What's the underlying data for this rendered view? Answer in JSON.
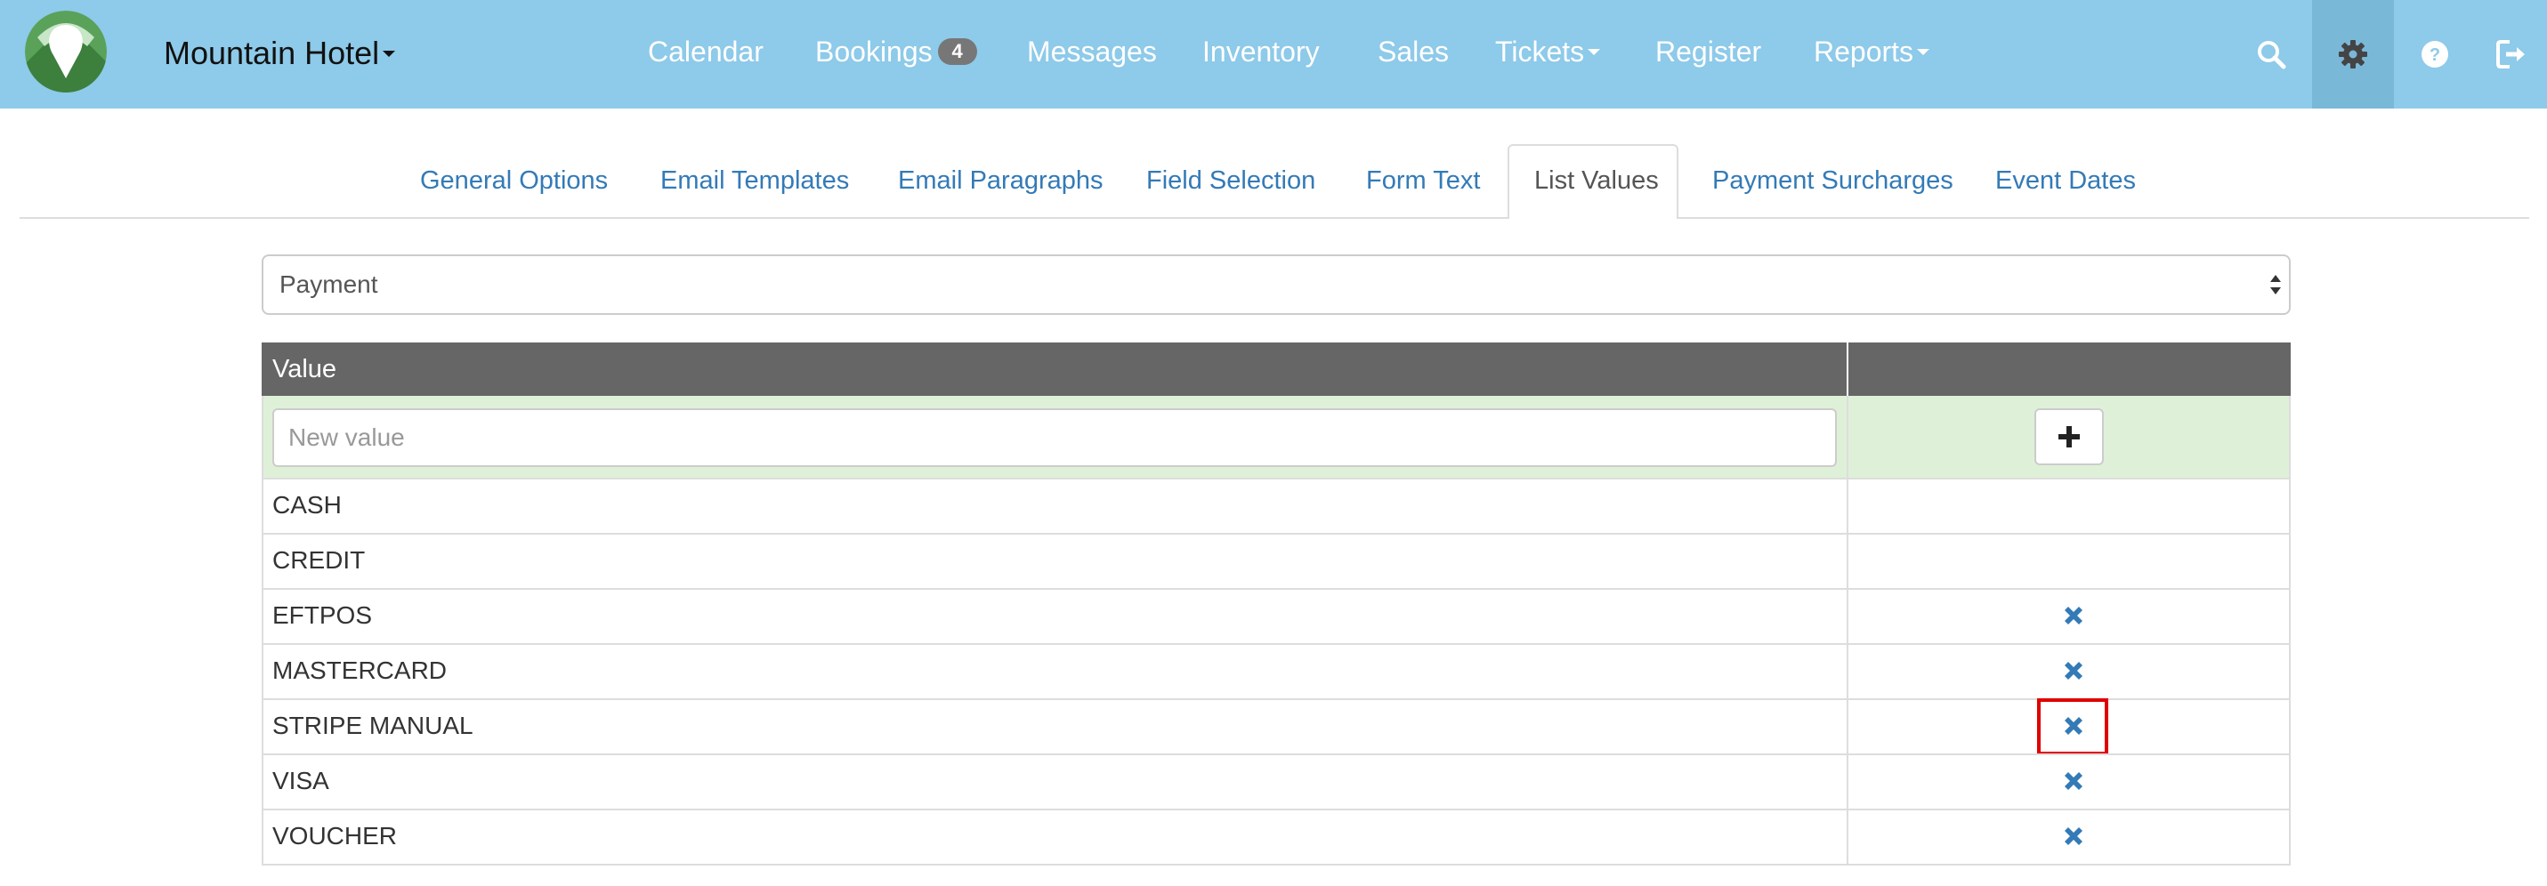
{
  "navbar": {
    "brand": "Mountain Hotel",
    "items": [
      {
        "label": "Calendar"
      },
      {
        "label": "Bookings",
        "badge": "4"
      },
      {
        "label": "Messages"
      },
      {
        "label": "Inventory"
      },
      {
        "label": "Sales"
      },
      {
        "label": "Tickets"
      },
      {
        "label": "Register"
      },
      {
        "label": "Reports"
      }
    ],
    "icons": [
      "search-icon",
      "gear-icon",
      "help-icon",
      "logout-icon"
    ],
    "colors": {
      "background": "#8ecae9",
      "active_icon_background": "#7ab8d8"
    }
  },
  "tabs": [
    {
      "label": "General Options"
    },
    {
      "label": "Email Templates"
    },
    {
      "label": "Email Paragraphs"
    },
    {
      "label": "Field Selection"
    },
    {
      "label": "Form Text"
    },
    {
      "label": "List Values",
      "active": true
    },
    {
      "label": "Payment Surcharges"
    },
    {
      "label": "Event Dates"
    }
  ],
  "list_select": {
    "selected": "Payment"
  },
  "table": {
    "header": {
      "value": "Value"
    },
    "new_value_placeholder": "New value",
    "add_icon": "plus-icon",
    "rows": [
      {
        "value": "CASH",
        "removable": false
      },
      {
        "value": "CREDIT",
        "removable": false
      },
      {
        "value": "EFTPOS",
        "removable": true
      },
      {
        "value": "MASTERCARD",
        "removable": true
      },
      {
        "value": "STRIPE MANUAL",
        "removable": true,
        "highlighted": true
      },
      {
        "value": "VISA",
        "removable": true
      },
      {
        "value": "VOUCHER",
        "removable": true
      }
    ],
    "colors": {
      "header_background": "#666666",
      "new_row_background": "#dff0d8",
      "remove_icon": "#337ab7",
      "highlight_border": "#e00000"
    }
  }
}
